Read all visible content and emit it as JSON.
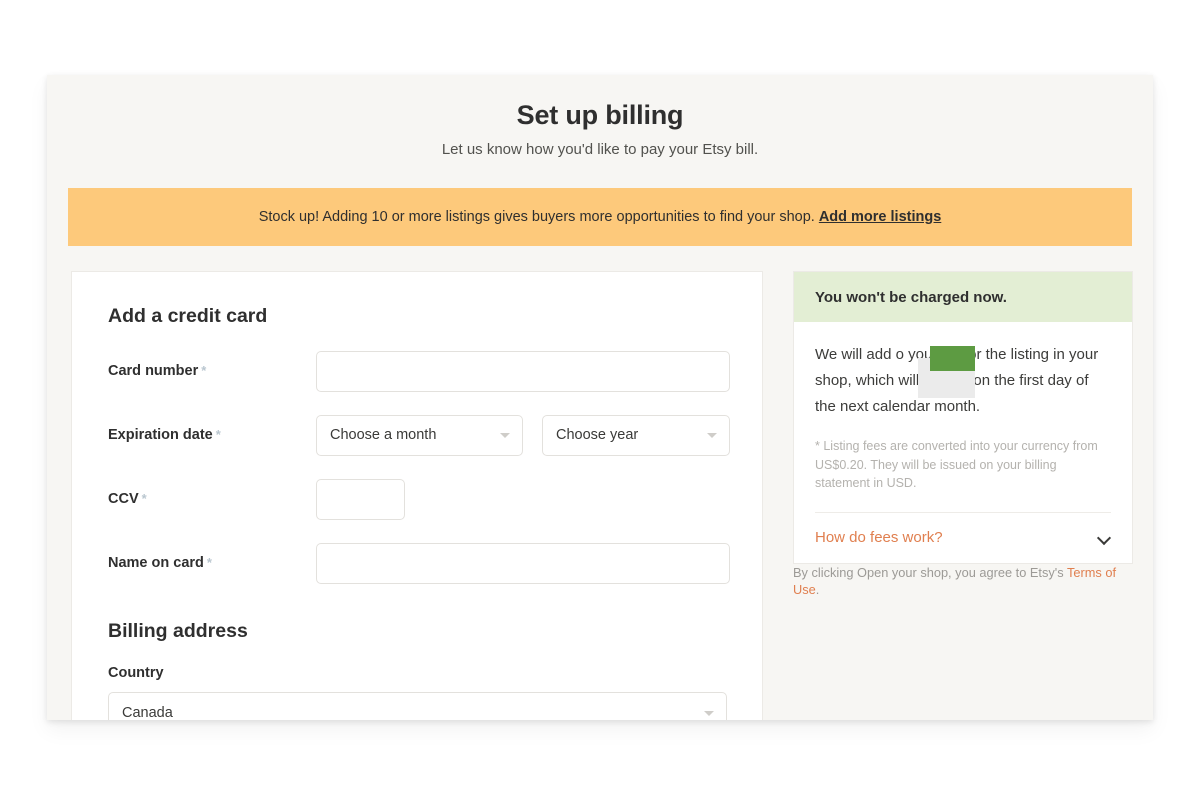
{
  "header": {
    "title": "Set up billing",
    "subtitle": "Let us know how you'd like to pay your Etsy bill."
  },
  "banner": {
    "text": "Stock up! Adding 10 or more listings gives buyers more opportunities to find your shop.",
    "link_label": "Add more listings",
    "background_color": "#fdc97b"
  },
  "credit_card": {
    "heading": "Add a credit card",
    "fields": {
      "card_number": {
        "label": "Card number",
        "required_marker": "*",
        "value": ""
      },
      "expiration": {
        "label": "Expiration date",
        "required_marker": "*",
        "month_value": "Choose a month",
        "year_value": "Choose year"
      },
      "ccv": {
        "label": "CCV",
        "required_marker": "*",
        "value": ""
      },
      "name_on_card": {
        "label": "Name on card",
        "required_marker": "*",
        "value": ""
      }
    }
  },
  "billing_address": {
    "heading": "Billing address",
    "country_label": "Country",
    "country_value": "Canada"
  },
  "sidebar": {
    "header_text": "You won't be charged now.",
    "body_text_before": "We will add",
    "body_text_after": "o your bill for the listing in your shop, which will be due on the first day of the next calendar month.",
    "footnote": "* Listing fees are converted into your currency from US$0.20. They will be issued on your billing statement in USD.",
    "fees_link_label": "How do fees work?",
    "chevron_icon": "chevron-down-icon",
    "header_color": "#e3eed4",
    "redaction_color": "#5d9b42"
  },
  "terms": {
    "text_before": "By clicking Open your shop, you agree to Etsy's ",
    "link_label": "Terms of Use",
    "text_after": ".",
    "link_color": "#e07f4f"
  }
}
